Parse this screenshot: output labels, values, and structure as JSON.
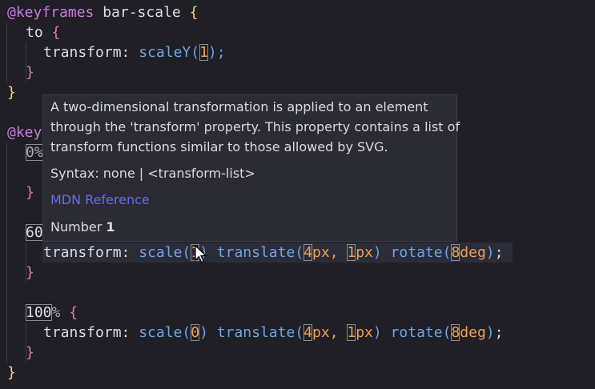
{
  "code": {
    "l1": {
      "at": "@keyframes",
      "name": " bar-scale ",
      "brace": "{"
    },
    "l2": {
      "to": "to",
      "brace": "{"
    },
    "l3": {
      "prop": "transform:",
      "fn": "scaleY(",
      "num": "1",
      "close": ");"
    },
    "l4": {
      "brace": "}"
    },
    "l5": {
      "brace": "}"
    },
    "l6": {
      "at": "@key"
    },
    "l7": {
      "sel": "0%"
    },
    "l8": {
      "brace": "}"
    },
    "l9": {
      "sel": "60"
    },
    "l10": {
      "prop": "transform:",
      "scale": "scale(",
      "n1": "1",
      "c1": ")",
      "translate": "translate(",
      "n2": "4",
      "u2": "px, ",
      "n3": "1",
      "u3": "px",
      "c2": ")",
      "rotate": "rotate(",
      "n4": "8",
      "u4": "deg",
      "c3": ")",
      "semi": ";"
    },
    "l11": {
      "brace": "}"
    },
    "l12": {
      "sel": "100",
      "pct": "%",
      "brace": "{"
    },
    "l13": {
      "prop": "transform:",
      "scale": "scale(",
      "n1": "0",
      "c1": ")",
      "translate": "translate(",
      "n2": "4",
      "u2": "px, ",
      "n3": "1",
      "u3": "px",
      "c2": ")",
      "rotate": "rotate(",
      "n4": "8",
      "u4": "deg",
      "c3": ")",
      "semi": ";"
    },
    "l14": {
      "brace": "}"
    },
    "l15": {
      "brace": "}"
    }
  },
  "tooltip": {
    "line1": "A two-dimensional transformation is applied to an element",
    "line2": "through the 'transform' property. This property contains a list of",
    "line3": "transform functions similar to those allowed by SVG.",
    "syntax": "Syntax: none | <transform-list>",
    "link": "MDN Reference",
    "number_label": "Number ",
    "number_value": "1"
  },
  "colors": {
    "background": "#1f1f25",
    "keyword": "#c77bdf",
    "function": "#6fa3e6",
    "number": "#f0a050",
    "brace": "#ffd76a",
    "nested_brace": "#e07ab0",
    "link": "#6a6cf0"
  },
  "icons": {
    "cursor": "mouse-pointer-icon"
  }
}
